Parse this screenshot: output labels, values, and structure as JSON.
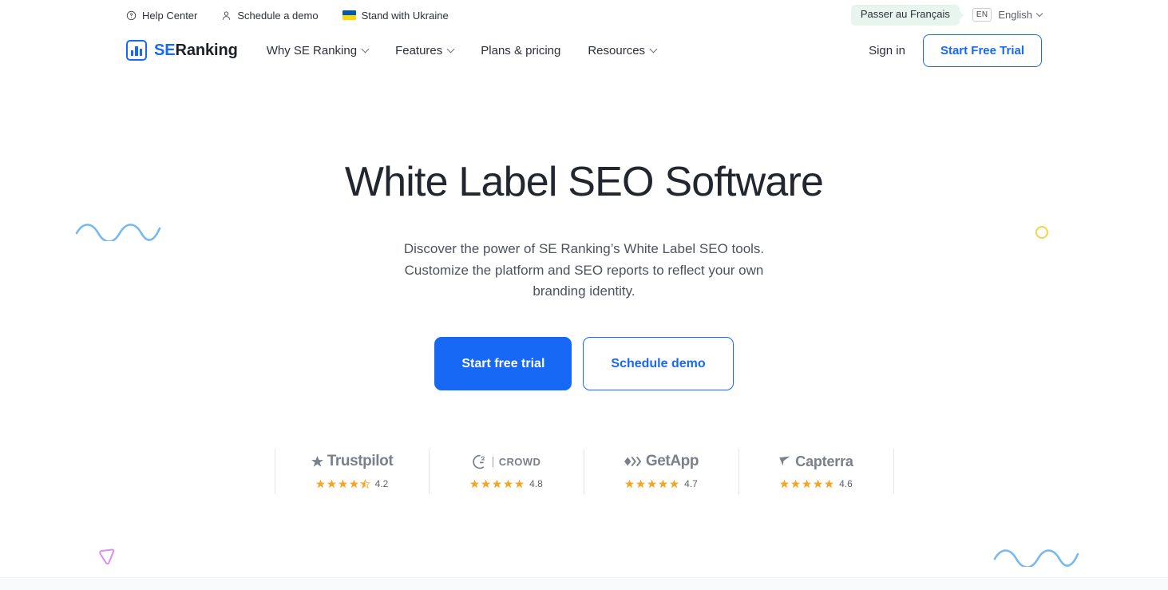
{
  "topbar": {
    "links": [
      {
        "label": "Help Center",
        "icon": "help-circle-icon"
      },
      {
        "label": "Schedule a demo",
        "icon": "user-icon"
      },
      {
        "label": "Stand with Ukraine",
        "icon": "ukraine-flag-icon"
      }
    ],
    "language": {
      "switch_prompt": "Passer au Français",
      "code": "EN",
      "current": "English"
    }
  },
  "nav": {
    "brand": {
      "se": "SE",
      "ranking": "Ranking"
    },
    "items": [
      {
        "label": "Why SE Ranking",
        "has_dropdown": true
      },
      {
        "label": "Features",
        "has_dropdown": true
      },
      {
        "label": "Plans & pricing",
        "has_dropdown": false
      },
      {
        "label": "Resources",
        "has_dropdown": true
      }
    ],
    "sign_in": "Sign in",
    "start_trial": "Start Free Trial"
  },
  "hero": {
    "title": "White Label SEO Software",
    "description": "Discover the power of SE Ranking’s White Label SEO tools. Customize the platform and SEO reports to reflect your own branding identity.",
    "primary_cta": "Start free trial",
    "secondary_cta": "Schedule demo"
  },
  "reviews": [
    {
      "name": "Trustpilot",
      "rating": "4.2",
      "stars": 4.5,
      "logo_icon": "trustpilot-star-icon"
    },
    {
      "name": "CROWD",
      "rating": "4.8",
      "stars": 5,
      "logo_icon": "g2-crowd-icon"
    },
    {
      "name": "GetApp",
      "rating": "4.7",
      "stars": 5,
      "logo_icon": "getapp-chevrons-icon"
    },
    {
      "name": "Capterra",
      "rating": "4.6",
      "stars": 5,
      "logo_icon": "capterra-arrow-icon"
    }
  ],
  "colors": {
    "brand_blue": "#1769f5",
    "star_orange": "#f5a623",
    "wave_blue": "#74b9f0",
    "circle_yellow": "#f8d04a",
    "triangle_pink": "#d98ef0",
    "tooltip_green": "#e7f5ee"
  }
}
